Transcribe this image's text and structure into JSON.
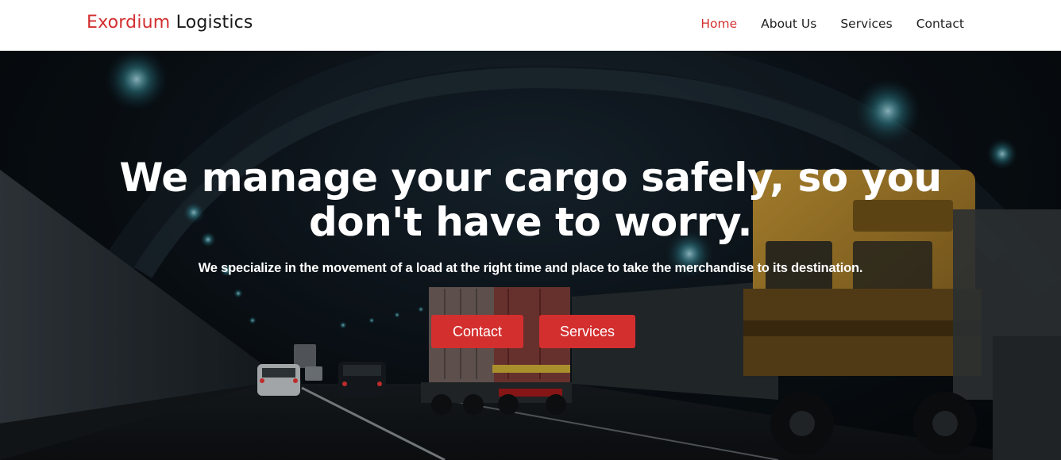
{
  "header": {
    "brand_accent": "Exordium",
    "brand_rest": "Logistics",
    "nav": [
      {
        "label": "Home",
        "active": true
      },
      {
        "label": "About Us",
        "active": false
      },
      {
        "label": "Services",
        "active": false
      },
      {
        "label": "Contact",
        "active": false
      }
    ]
  },
  "hero": {
    "title_line1": "We manage your cargo safely, so you",
    "title_line2": "don't have to worry.",
    "subtitle": "We specialize in the movement of a load at the right time and place to take the merchandise to its destination.",
    "buttons": {
      "contact_label": "Contact",
      "services_label": "Services"
    }
  },
  "colors": {
    "accent": "#d32f2f",
    "header_bg": "#ffffff",
    "text_dark": "#1f1f1f"
  }
}
